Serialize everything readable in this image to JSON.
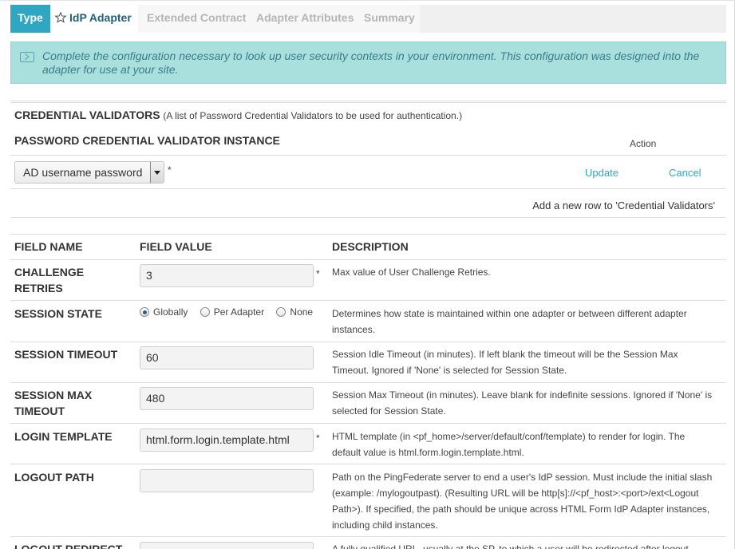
{
  "tabs": [
    {
      "label": "Type"
    },
    {
      "label": "IdP Adapter"
    },
    {
      "label": "Extended Contract"
    },
    {
      "label": "Adapter Attributes"
    },
    {
      "label": "Summary"
    }
  ],
  "banner": {
    "text": "Complete the configuration necessary to look up user security contexts in your environment. This configuration was designed into the adapter for use at your site."
  },
  "credential_validators": {
    "title": "CREDENTIAL VALIDATORS",
    "note": "(A list of Password Credential Validators to be used for authentication.)",
    "instance_header": "PASSWORD CREDENTIAL VALIDATOR INSTANCE",
    "action_header": "Action",
    "selected": "AD username password",
    "required_mark": "*",
    "update_label": "Update",
    "cancel_label": "Cancel",
    "add_row_label": "Add a new row to 'Credential Validators'"
  },
  "fields_table": {
    "headers": [
      "FIELD NAME",
      "FIELD VALUE",
      "DESCRIPTION"
    ],
    "required_mark": "*",
    "rows": [
      {
        "name_line1": "CHALLENGE",
        "name_line2": "RETRIES",
        "value": "3",
        "description": "Max value of User Challenge Retries."
      },
      {
        "name_line1": "SESSION STATE",
        "description": "Determines how state is maintained within one adapter or between different adapter instances."
      },
      {
        "name_line1": "SESSION TIMEOUT",
        "value": "60",
        "description": "Session Idle Timeout (in minutes). If left blank the timeout will be the Session Max Timeout. Ignored if 'None' is selected for Session State."
      },
      {
        "name_line1": "SESSION MAX",
        "name_line2": "TIMEOUT",
        "value": "480",
        "description": "Session Max Timeout (in minutes). Leave blank for indefinite sessions. Ignored if 'None' is selected for Session State."
      },
      {
        "name_line1": "LOGIN TEMPLATE",
        "value": "html.form.login.template.html",
        "description": "HTML template (in <pf_home>/server/default/conf/template) to render for login. The default value is html.form.login.template.html."
      },
      {
        "name_line1": "LOGOUT PATH",
        "value": "",
        "description": "Path on the PingFederate server to end a user's IdP session. Must include the initial slash (example: /mylogoutpast). (Resulting URL will be http[s]://<pf_host>:<port>/ext<Logout Path>). If specified, the path should be unique across HTML Form IdP Adapter instances, including child instances."
      },
      {
        "name_line1": "LOGOUT REDIRECT",
        "value": "",
        "description": "A fully qualified URL, usually at the SP, to which a user will be redirected after logout."
      }
    ],
    "session_state_options": [
      {
        "label": "Globally",
        "selected": true
      },
      {
        "label": "Per Adapter",
        "selected": false
      },
      {
        "label": "None",
        "selected": false
      }
    ]
  }
}
